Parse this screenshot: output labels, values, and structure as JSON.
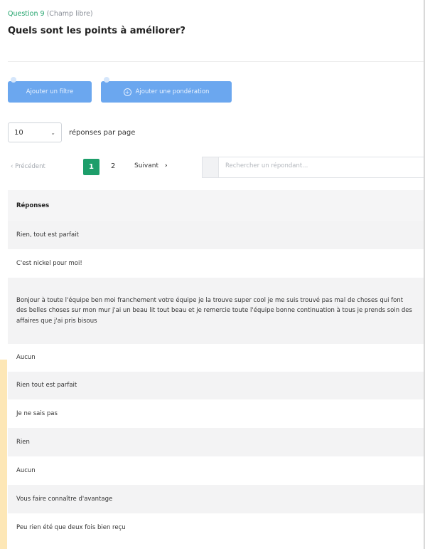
{
  "question": {
    "number": "Question 9",
    "type": "(Champ libre)",
    "title": "Quels sont les points à améliorer?"
  },
  "actions": {
    "add_filter": "Ajouter un filtre",
    "add_weighting": "Ajouter une pondération"
  },
  "pagination": {
    "per_page_value": "10",
    "per_page_label": "réponses par page",
    "prev": "Précédent",
    "page_1": "1",
    "page_2": "2",
    "next": "Suivant",
    "current_page": 1
  },
  "search": {
    "placeholder": "Rechercher un répondant..."
  },
  "table": {
    "header": "Réponses",
    "rows": [
      "Rien, tout est parfait",
      "C'est nickel pour moi!",
      "Bonjour à toute l'équipe ben moi franchement votre équipe je la trouve super cool je me suis trouvé pas mal de choses qui font des belles choses sur mon mur j'ai un beau lit tout beau et je remercie toute l'équipe bonne continuation à tous je prends soin des affaires que j'ai pris bisous",
      "Aucun",
      "Rien tout est parfait",
      "Je ne sais pas",
      "Rien",
      "Aucun",
      "Vous faire connaître d'avantage",
      "Peu rien été que deux fois bien reçu"
    ]
  },
  "colors": {
    "accent_green": "#1d9e6a",
    "button_blue": "#6ba7ef"
  }
}
